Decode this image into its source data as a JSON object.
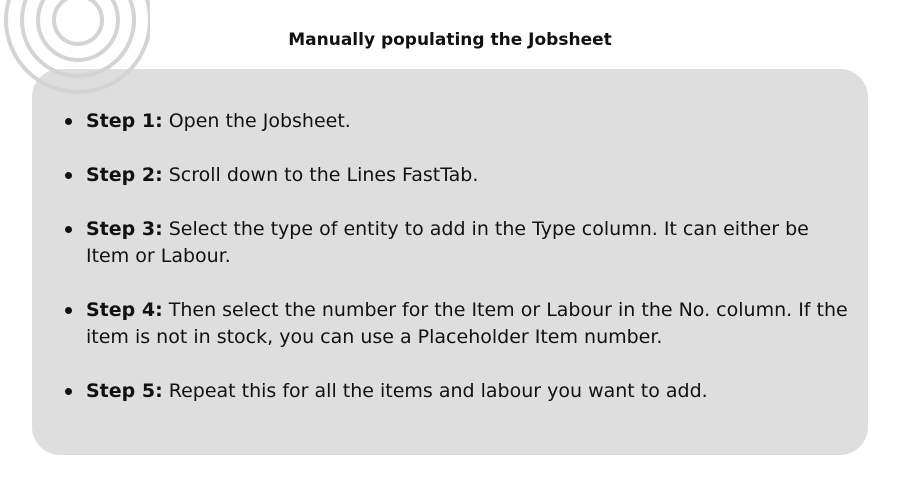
{
  "header": {
    "title": "Manually populating the Jobsheet"
  },
  "steps": [
    {
      "label": "Step 1:",
      "text": " Open the Jobsheet."
    },
    {
      "label": "Step 2:",
      "text": " Scroll down to the Lines FastTab."
    },
    {
      "label": "Step 3:",
      "text": " Select the type of entity to add in the Type column. It can either be Item or Labour."
    },
    {
      "label": "Step 4:",
      "text": " Then select the number for the Item or Labour in the No. column. If the item is not in stock, you can use a Placeholder Item number."
    },
    {
      "label": "Step 5:",
      "text": " Repeat this for all the items and labour you want to add."
    }
  ],
  "colors": {
    "card_background": "#dedede",
    "text": "#111111",
    "decoration_rings": "#d4d4d4"
  },
  "icons": {
    "decoration": "concentric-circles-decoration",
    "bullet": "bullet-dot-icon"
  }
}
